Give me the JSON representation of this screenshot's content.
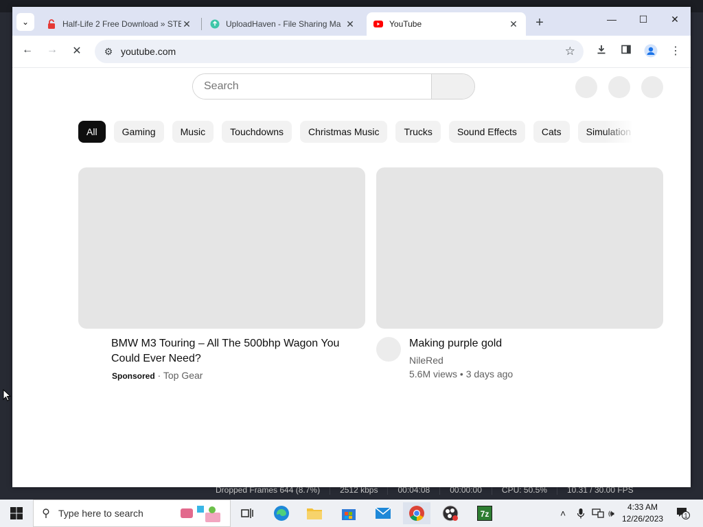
{
  "background_app": {
    "status": {
      "dropped_frames": "Dropped Frames 644 (8.7%)",
      "bitrate": "2512 kbps",
      "rec_time": "00:04:08",
      "stream_time": "00:00:00",
      "cpu": "CPU: 50.5%",
      "fps": "10.31 / 30.00 FPS"
    }
  },
  "browser": {
    "tabs": [
      {
        "title": "Half-Life 2 Free Download » STE",
        "favicon": "lock-red-icon",
        "active": false
      },
      {
        "title": "UploadHaven - File Sharing Ma",
        "favicon": "uploadhaven-icon",
        "active": false
      },
      {
        "title": "YouTube",
        "favicon": "youtube-icon",
        "active": true
      }
    ],
    "url": "youtube.com"
  },
  "youtube": {
    "search_placeholder": "Search",
    "chips": [
      "All",
      "Gaming",
      "Music",
      "Touchdowns",
      "Christmas Music",
      "Trucks",
      "Sound Effects",
      "Cats",
      "Simulation"
    ],
    "active_chip": "All",
    "videos": [
      {
        "title": "BMW M3 Touring – All The 500bhp Wagon You Could Ever Need?",
        "sponsored_label": "Sponsored",
        "separator": " · ",
        "channel": "Top Gear"
      },
      {
        "title": "Making purple gold",
        "channel": "NileRed",
        "stats": "5.6M views • 3 days ago"
      }
    ]
  },
  "taskbar": {
    "search_placeholder": "Type here to search",
    "apps": [
      "task-view-icon",
      "edge-icon",
      "file-explorer-icon",
      "store-icon",
      "mail-icon",
      "chrome-icon",
      "obs-icon",
      "7zip-icon"
    ],
    "time": "4:33 AM",
    "date": "12/26/2023",
    "notification_count": "1"
  },
  "colors": {
    "accent": "#0f0f0f",
    "tabstrip": "#dee3f3",
    "youtube_red": "#ff0000",
    "chrome_blue": "#1a73e8"
  }
}
